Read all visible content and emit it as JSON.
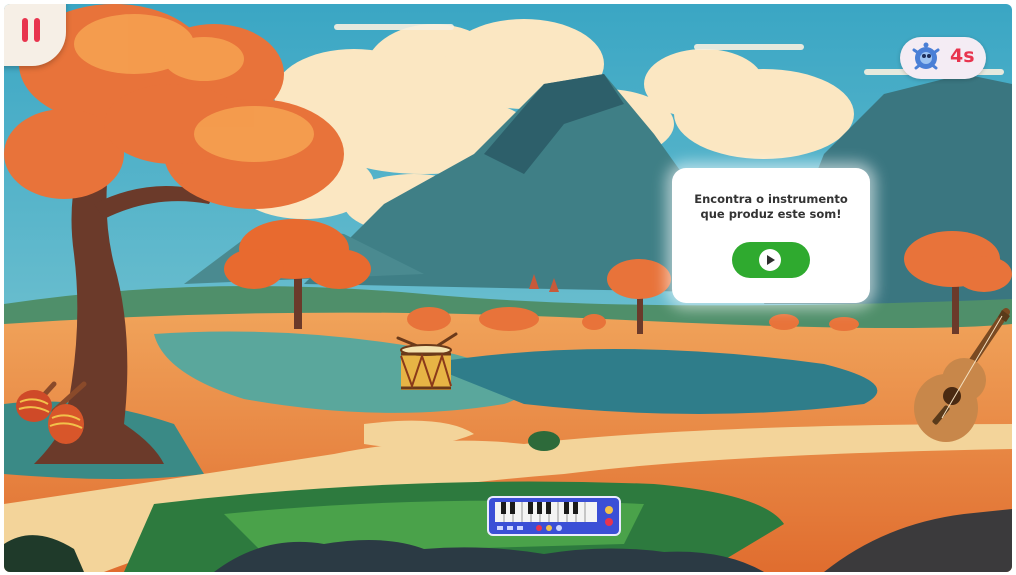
{
  "pause_button": {
    "icon": "pause-icon",
    "color": "#e8344e"
  },
  "timer": {
    "value": "4s",
    "icon": "mascot-icon",
    "color": "#e8344e"
  },
  "prompt_card": {
    "text": "Encontra o instrumento\nque produz este som!",
    "play_icon": "play-icon",
    "button_color": "#2faa2f"
  },
  "instruments": [
    {
      "name": "maracas",
      "icon": "maracas-icon"
    },
    {
      "name": "drum",
      "icon": "drum-icon"
    },
    {
      "name": "keyboard",
      "icon": "keyboard-icon"
    },
    {
      "name": "guitar",
      "icon": "guitar-icon"
    }
  ]
}
